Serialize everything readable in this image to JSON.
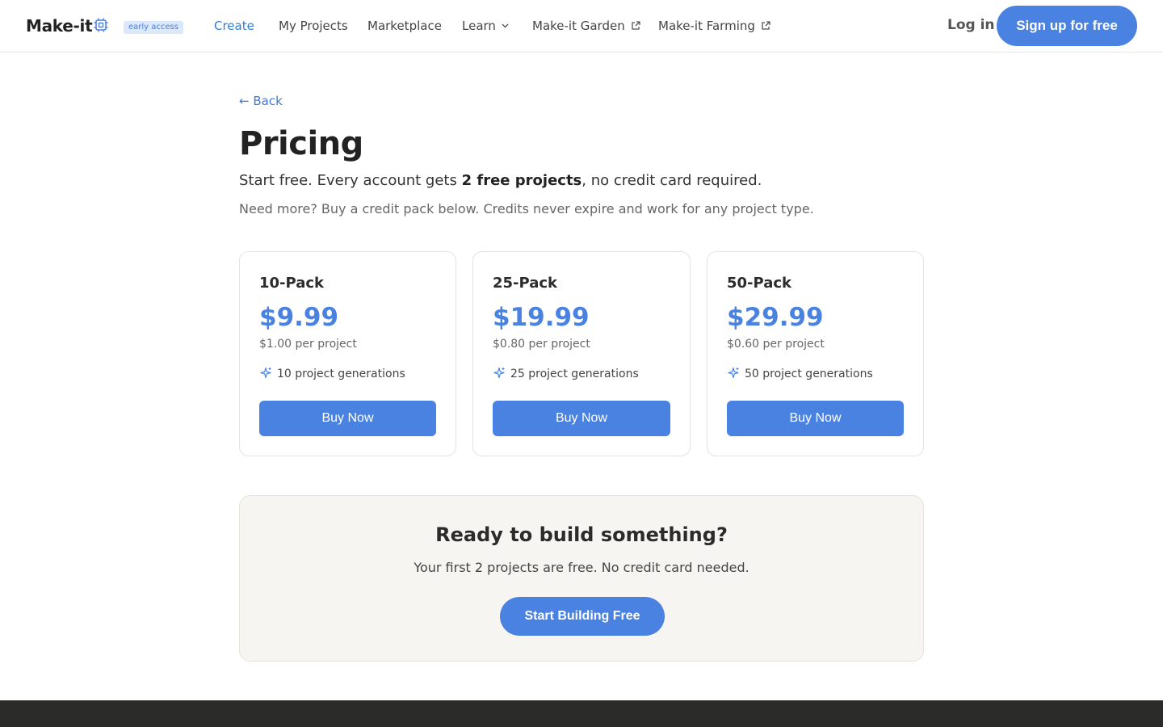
{
  "header": {
    "logo": "Make-it",
    "logo_icon": "chip-icon",
    "badge": "early access",
    "nav": [
      {
        "label": "Create",
        "active": true
      },
      {
        "label": "My Projects"
      },
      {
        "label": "Marketplace"
      },
      {
        "label": "Learn",
        "icon": "chevron-down-icon"
      },
      {
        "label": "Make-it Garden",
        "icon": "external-link-icon"
      },
      {
        "label": "Make-it Farming",
        "icon": "external-link-icon"
      }
    ],
    "login": "Log in",
    "signup": "Sign up for free"
  },
  "page": {
    "back": "← Back",
    "title": "Pricing",
    "subtitle_pre": "Start free. Every account gets ",
    "subtitle_bold": "2 free projects",
    "subtitle_post": ", no credit card required.",
    "note": "Need more? Buy a credit pack below. Credits never expire and work for any project type."
  },
  "packs": [
    {
      "name": "10-Pack",
      "price": "$9.99",
      "per": "$1.00 per project",
      "feature": "10 project generations",
      "button": "Buy Now"
    },
    {
      "name": "25-Pack",
      "price": "$19.99",
      "per": "$0.80 per project",
      "feature": "25 project generations",
      "button": "Buy Now"
    },
    {
      "name": "50-Pack",
      "price": "$29.99",
      "per": "$0.60 per project",
      "feature": "50 project generations",
      "button": "Buy Now"
    }
  ],
  "cta": {
    "title": "Ready to build something?",
    "subtitle": "Your first 2 projects are free. No credit card needed.",
    "button": "Start Building Free"
  },
  "colors": {
    "accent": "#4a82e2",
    "nav_active": "#2f7fd8",
    "footer": "#2b2b29",
    "cta_bg": "#f7f5f1"
  }
}
